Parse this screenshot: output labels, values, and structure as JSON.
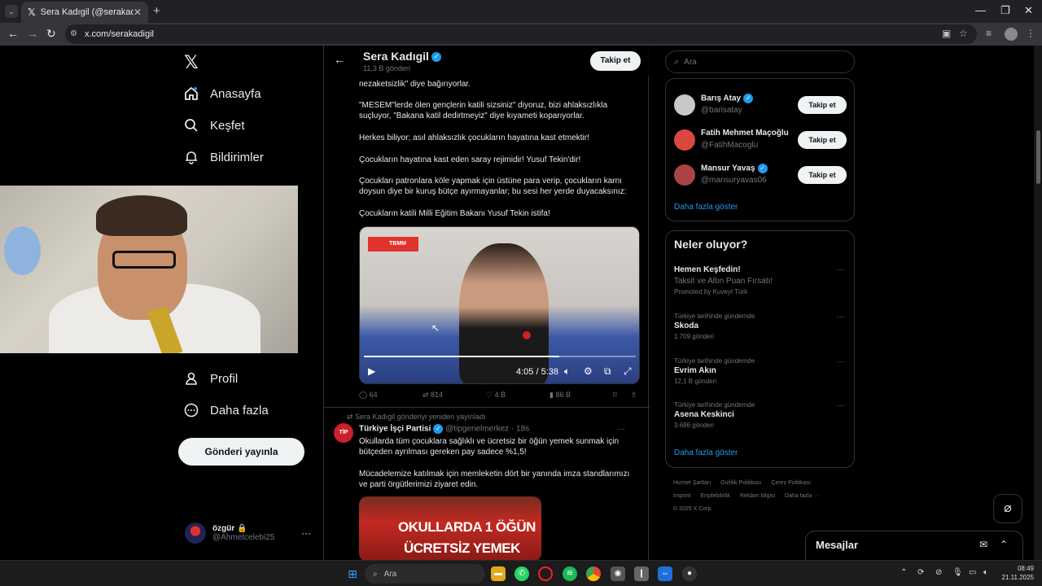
{
  "browser": {
    "tab_title": "Sera Kadıgil (@serakadigil) / X",
    "url": "x.com/serakadigil"
  },
  "nav": {
    "items": [
      {
        "label": "Anasayfa",
        "icon": "home-icon"
      },
      {
        "label": "Keşfet",
        "icon": "search-icon"
      },
      {
        "label": "Bildirimler",
        "icon": "bell-icon"
      },
      {
        "label": "Profil",
        "icon": "person-icon"
      },
      {
        "label": "Daha fazla",
        "icon": "more-circle-icon"
      }
    ],
    "post_button": "Gönderi yayınla",
    "account": {
      "name": "özgür 🔒",
      "handle": "@Ahmetcelebi25"
    }
  },
  "profile_header": {
    "name": "Sera Kadıgil",
    "post_count": "11,3 B gönderi",
    "follow_label": "Takip et"
  },
  "tweet1": {
    "lines": [
      "nezaketsizlik\" diye bağırıyorlar.",
      "\"MESEM\"lerde ölen gençlerin katili sizsiniz\" diyoruz, bizi ahlaksızlıkla suçluyor, \"Bakana katil dedirtmeyiz\" diye kıyameti koparıyorlar.",
      "Herkes biliyor; asıl ahlaksızlık çocukların hayatına kast etmektir!",
      "Çocukların hayatına kast eden saray rejimidir! Yusuf Tekin'dir!",
      "Çocukları patronlara köle yapmak için üstüne para verip, çocukların karnı doysun diye bir kuruş bütçe ayırmayanlar; bu sesi her yerde duyacaksınız:",
      "Çocukların katili Milli Eğitim Bakanı Yusuf Tekin istifa!"
    ],
    "video": {
      "badge": "TBMM",
      "time": "4:05 / 5:38",
      "progress": 0.72
    },
    "stats": {
      "replies": "64",
      "reposts": "814",
      "likes": "4 B",
      "views": "86 B"
    }
  },
  "tweet2": {
    "repost_note": "Sera Kadıgil gönderiyi yeniden yayınladı",
    "avatar_text": "TİP",
    "author": "Türkiye İşçi Partisi",
    "handle": "@tipgenelmerkez",
    "time": "· 18s",
    "text1": "Okullarda tüm çocuklara sağlıklı ve ücretsiz bir öğün yemek sunmak için bütçeden ayrılması gereken pay sadece %1,5!",
    "text2": "Mücadelemize katılmak için memleketin dört bir yanında imza standlarımızı ve parti örgütlerimizi ziyaret edin.",
    "image_line1": "OKULLARDA 1 ÖĞÜN",
    "image_line2": "ÜCRETSİZ YEMEK"
  },
  "right": {
    "search_placeholder": "Ara",
    "who_to_follow": [
      {
        "name": "Barış Atay",
        "handle": "@barisatay",
        "verified": true
      },
      {
        "name": "Fatih Mehmet Maçoğlu",
        "handle": "@FatihMacoglu",
        "verified": false
      },
      {
        "name": "Mansur Yavaş",
        "handle": "@mansuryavas06",
        "verified": true
      }
    ],
    "follow_label": "Takip et",
    "show_more": "Daha fazla göster",
    "trends_title": "Neler oluyor?",
    "promo": {
      "title": "Hemen Keşfedin!",
      "subtitle": "Taksit ve Altın Puan Fırsatı!",
      "promoted": "Promoted by Kuveyt Türk"
    },
    "trends": [
      {
        "context": "Türkiye tarihinde gündemde",
        "name": "Skoda",
        "count": "1.709 gönderi"
      },
      {
        "context": "Türkiye tarihinde gündemde",
        "name": "Evrim Akın",
        "count": "12,1 B gönderi"
      },
      {
        "context": "Türkiye tarihinde gündemde",
        "name": "Asena Keskinci",
        "count": "3.686 gönderi"
      }
    ],
    "footer": [
      "Hizmet Şartları",
      "Gizlilik Politikası",
      "Çerez Politikası",
      "Imprint",
      "Erişilebilirlik",
      "Reklam bilgisi",
      "Daha fazla ···",
      "© 2025 X Corp."
    ],
    "messages": "Mesajlar"
  },
  "taskbar": {
    "search": "Ara",
    "time": "08:49",
    "date": "21.11.2025"
  }
}
